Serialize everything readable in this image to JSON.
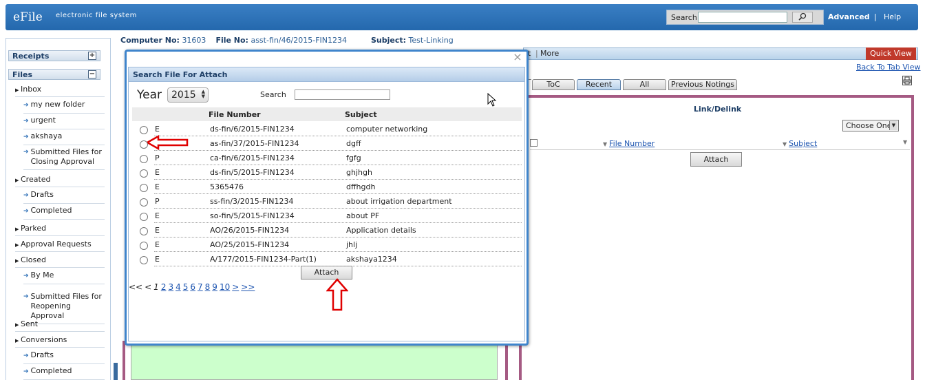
{
  "app": {
    "logo": "eFile",
    "tagline": "electronic file system",
    "search_label": "Search",
    "advanced": "Advanced",
    "separator": "|",
    "help": "Help"
  },
  "info": {
    "computer_label": "Computer No:",
    "computer_value": "31603",
    "file_label": "File No:",
    "file_value": "asst-fin/46/2015-FIN1234",
    "subject_label": "Subject:",
    "subject_value": "Test-Linking"
  },
  "sidebar": {
    "receipts": "Receipts",
    "receipts_toggle": "+",
    "files": "Files",
    "files_toggle": "−",
    "items": [
      {
        "label": "Inbox",
        "kind": "item"
      },
      {
        "label": "my new folder",
        "kind": "sub"
      },
      {
        "label": "urgent",
        "kind": "sub"
      },
      {
        "label": "akshaya",
        "kind": "sub"
      },
      {
        "label": "Submitted Files for Closing Approval",
        "kind": "sub"
      },
      {
        "label": "Created",
        "kind": "item"
      },
      {
        "label": "Drafts",
        "kind": "sub"
      },
      {
        "label": "Completed",
        "kind": "sub"
      },
      {
        "label": "Parked",
        "kind": "item"
      },
      {
        "label": "Approval Requests",
        "kind": "item"
      },
      {
        "label": "Closed",
        "kind": "item"
      },
      {
        "label": "By Me",
        "kind": "sub"
      },
      {
        "label": "Submitted Files for Reopening Approval",
        "kind": "sub"
      },
      {
        "label": "Sent",
        "kind": "item"
      },
      {
        "label": "Conversions",
        "kind": "item"
      },
      {
        "label": "Drafts",
        "kind": "sub"
      },
      {
        "label": "Completed",
        "kind": "sub"
      }
    ]
  },
  "toolbar": {
    "fragment": "t",
    "more": "More",
    "quick_view": "Quick View",
    "back_to_tab": "Back To Tab View"
  },
  "tabs": [
    {
      "label": "ToC"
    },
    {
      "label": "Recent"
    },
    {
      "label": "All"
    },
    {
      "label": "Previous Notings"
    }
  ],
  "link_panel": {
    "title": "Link/Delink",
    "choose": "Choose One",
    "col_file": "File Number",
    "col_subject": "Subject",
    "attach": "Attach"
  },
  "modal": {
    "close": "×",
    "title": "Search File For Attach",
    "year_label": "Year",
    "year_value": "2015",
    "search_label": "Search",
    "col_file": "File Number",
    "col_subject": "Subject",
    "attach": "Attach",
    "rows": [
      {
        "type": "E",
        "file": "ds-fin/6/2015-FIN1234",
        "subject": "computer networking"
      },
      {
        "type": "",
        "file": "as-fin/37/2015-FIN1234",
        "subject": "dgff"
      },
      {
        "type": "P",
        "file": "ca-fin/6/2015-FIN1234",
        "subject": "fgfg"
      },
      {
        "type": "E",
        "file": "ds-fin/5/2015-FIN1234",
        "subject": "ghjhgh"
      },
      {
        "type": "E",
        "file": "5365476",
        "subject": "dffhgdh"
      },
      {
        "type": "P",
        "file": "ss-fin/3/2015-FIN1234",
        "subject": "about irrigation department"
      },
      {
        "type": "E",
        "file": "so-fin/5/2015-FIN1234",
        "subject": "about PF"
      },
      {
        "type": "E",
        "file": "AO/26/2015-FIN1234",
        "subject": "Application details"
      },
      {
        "type": "E",
        "file": "AO/25/2015-FIN1234",
        "subject": "jhlj"
      },
      {
        "type": "E",
        "file": "A/177/2015-FIN1234-Part(1)",
        "subject": "akshaya1234"
      }
    ],
    "pager": {
      "first": "<<",
      "prev": "<",
      "current": "1",
      "pages": [
        "2",
        "3",
        "4",
        "5",
        "6",
        "7",
        "8",
        "9",
        "10"
      ],
      "next": ">",
      "last": ">>"
    }
  },
  "colors": {
    "banner": "#2468ad",
    "accent_border": "#3f85cc",
    "panel_border": "#a55a83",
    "quick_view": "#c0392b",
    "annotation_arrow": "#e00000",
    "notesheet": "#ccffcc"
  },
  "icons": {
    "search_go": "magnifier-icon",
    "print": "printer-icon",
    "cursor": "mouse-pointer-icon",
    "annotation": "red-arrow-icon"
  }
}
